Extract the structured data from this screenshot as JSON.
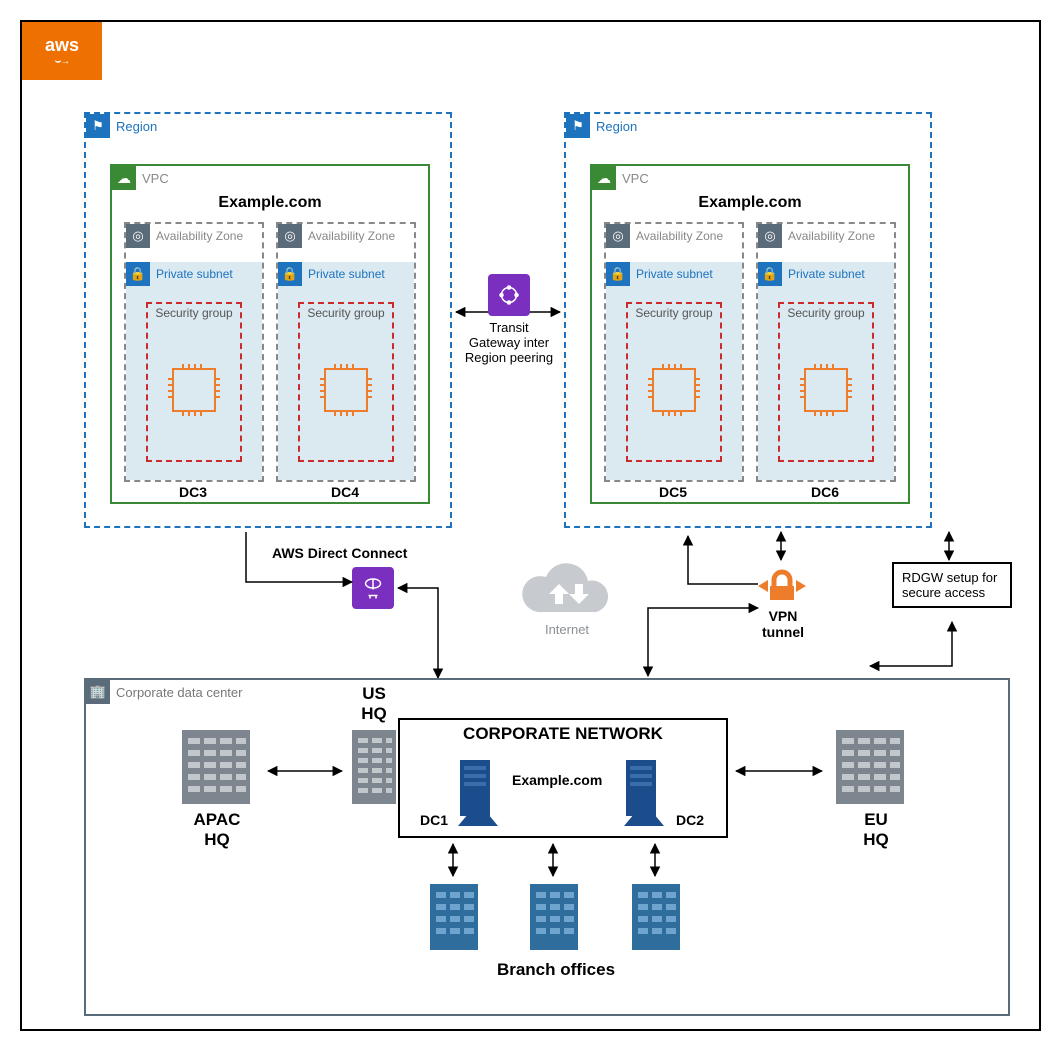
{
  "cloud": {
    "logo_text": "aws"
  },
  "regions": {
    "left": {
      "label": "Region",
      "vpc": {
        "label": "VPC",
        "domain": "Example.com",
        "zones": [
          {
            "az_label": "Availability Zone",
            "subnet_label": "Private subnet",
            "sg_label": "Security group",
            "dc": "DC3"
          },
          {
            "az_label": "Availability Zone",
            "subnet_label": "Private subnet",
            "sg_label": "Security group",
            "dc": "DC4"
          }
        ]
      }
    },
    "right": {
      "label": "Region",
      "vpc": {
        "label": "VPC",
        "domain": "Example.com",
        "zones": [
          {
            "az_label": "Availability Zone",
            "subnet_label": "Private subnet",
            "sg_label": "Security group",
            "dc": "DC5"
          },
          {
            "az_label": "Availability Zone",
            "subnet_label": "Private subnet",
            "sg_label": "Security group",
            "dc": "DC6"
          }
        ]
      }
    }
  },
  "transit_gateway_label": "Transit Gateway inter Region peering",
  "direct_connect_label": "AWS Direct Connect",
  "internet_label": "Internet",
  "vpn_label": "VPN tunnel",
  "rdgw_label": "RDGW setup for secure access",
  "corporate": {
    "box_label": "Corporate data center",
    "apac": "APAC HQ",
    "us": "US HQ",
    "eu": "EU HQ",
    "net_title": "CORPORATE NETWORK",
    "domain": "Example.com",
    "dc1": "DC1",
    "dc2": "DC2",
    "branch": "Branch offices"
  },
  "colors": {
    "aws_orange": "#ED7000",
    "aws_blue": "#1E73BE",
    "aws_green": "#3A8A35",
    "aws_purple": "#7B2FBF",
    "aws_red": "#cc2b2b",
    "aws_compute_orange": "#ED7D2B",
    "corp_grey": "#5A6B7A",
    "server_blue": "#1B4C8C"
  }
}
